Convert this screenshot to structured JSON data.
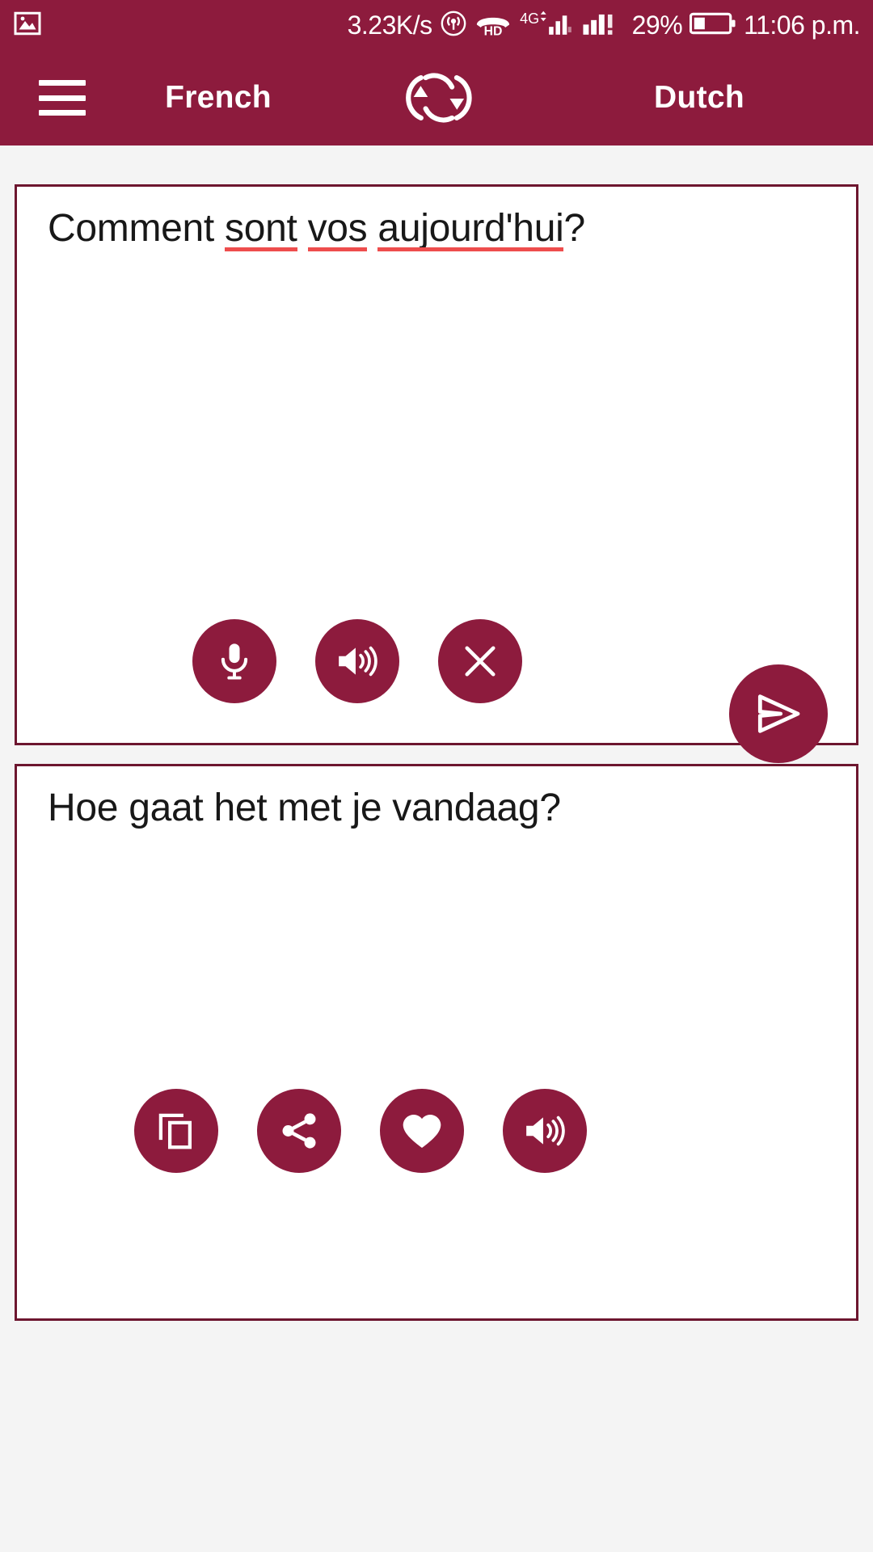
{
  "status_bar": {
    "network_speed": "3.23K/s",
    "battery_percent": "29%",
    "time": "11:06 p.m.",
    "icons": {
      "gallery": "image-icon",
      "hotspot": "hotspot-icon",
      "hd_voice": "hd-call-icon",
      "network_type": "4G",
      "signal_one": "signal-bars-icon",
      "signal_two": "signal-bars-icon",
      "battery": "battery-icon"
    }
  },
  "app_bar": {
    "menu_label": "menu",
    "source_language": "French",
    "target_language": "Dutch",
    "swap_label": "swap-languages"
  },
  "source_card": {
    "text_segments": [
      {
        "text": "Comment ",
        "misspelled": false
      },
      {
        "text": "sont",
        "misspelled": true
      },
      {
        "text": " ",
        "misspelled": false
      },
      {
        "text": "vos",
        "misspelled": true
      },
      {
        "text": " ",
        "misspelled": false
      },
      {
        "text": "aujourd'hui",
        "misspelled": true
      },
      {
        "text": "?",
        "misspelled": false
      }
    ],
    "full_text": "Comment sont vos aujourd'hui?",
    "actions": [
      {
        "name": "microphone-button",
        "icon": "microphone-icon",
        "label": "Speak"
      },
      {
        "name": "speak-source-button",
        "icon": "speaker-icon",
        "label": "Listen"
      },
      {
        "name": "clear-button",
        "icon": "close-icon",
        "label": "Clear"
      }
    ]
  },
  "send_button": {
    "name": "translate-send-button",
    "icon": "send-icon",
    "label": "Translate"
  },
  "target_card": {
    "full_text": "Hoe gaat het met je vandaag?",
    "actions": [
      {
        "name": "copy-button",
        "icon": "copy-icon",
        "label": "Copy"
      },
      {
        "name": "share-button",
        "icon": "share-icon",
        "label": "Share"
      },
      {
        "name": "favorite-button",
        "icon": "heart-icon",
        "label": "Favorite"
      },
      {
        "name": "speak-target-button",
        "icon": "speaker-icon",
        "label": "Listen"
      }
    ]
  },
  "colors": {
    "brand": "#8d1b3d",
    "card_border": "#6d162f",
    "page_background": "#f4f4f4",
    "card_background": "#ffffff",
    "text": "#181818",
    "spellcheck_underline": "#ee4d4d",
    "on_brand": "#ffffff"
  }
}
